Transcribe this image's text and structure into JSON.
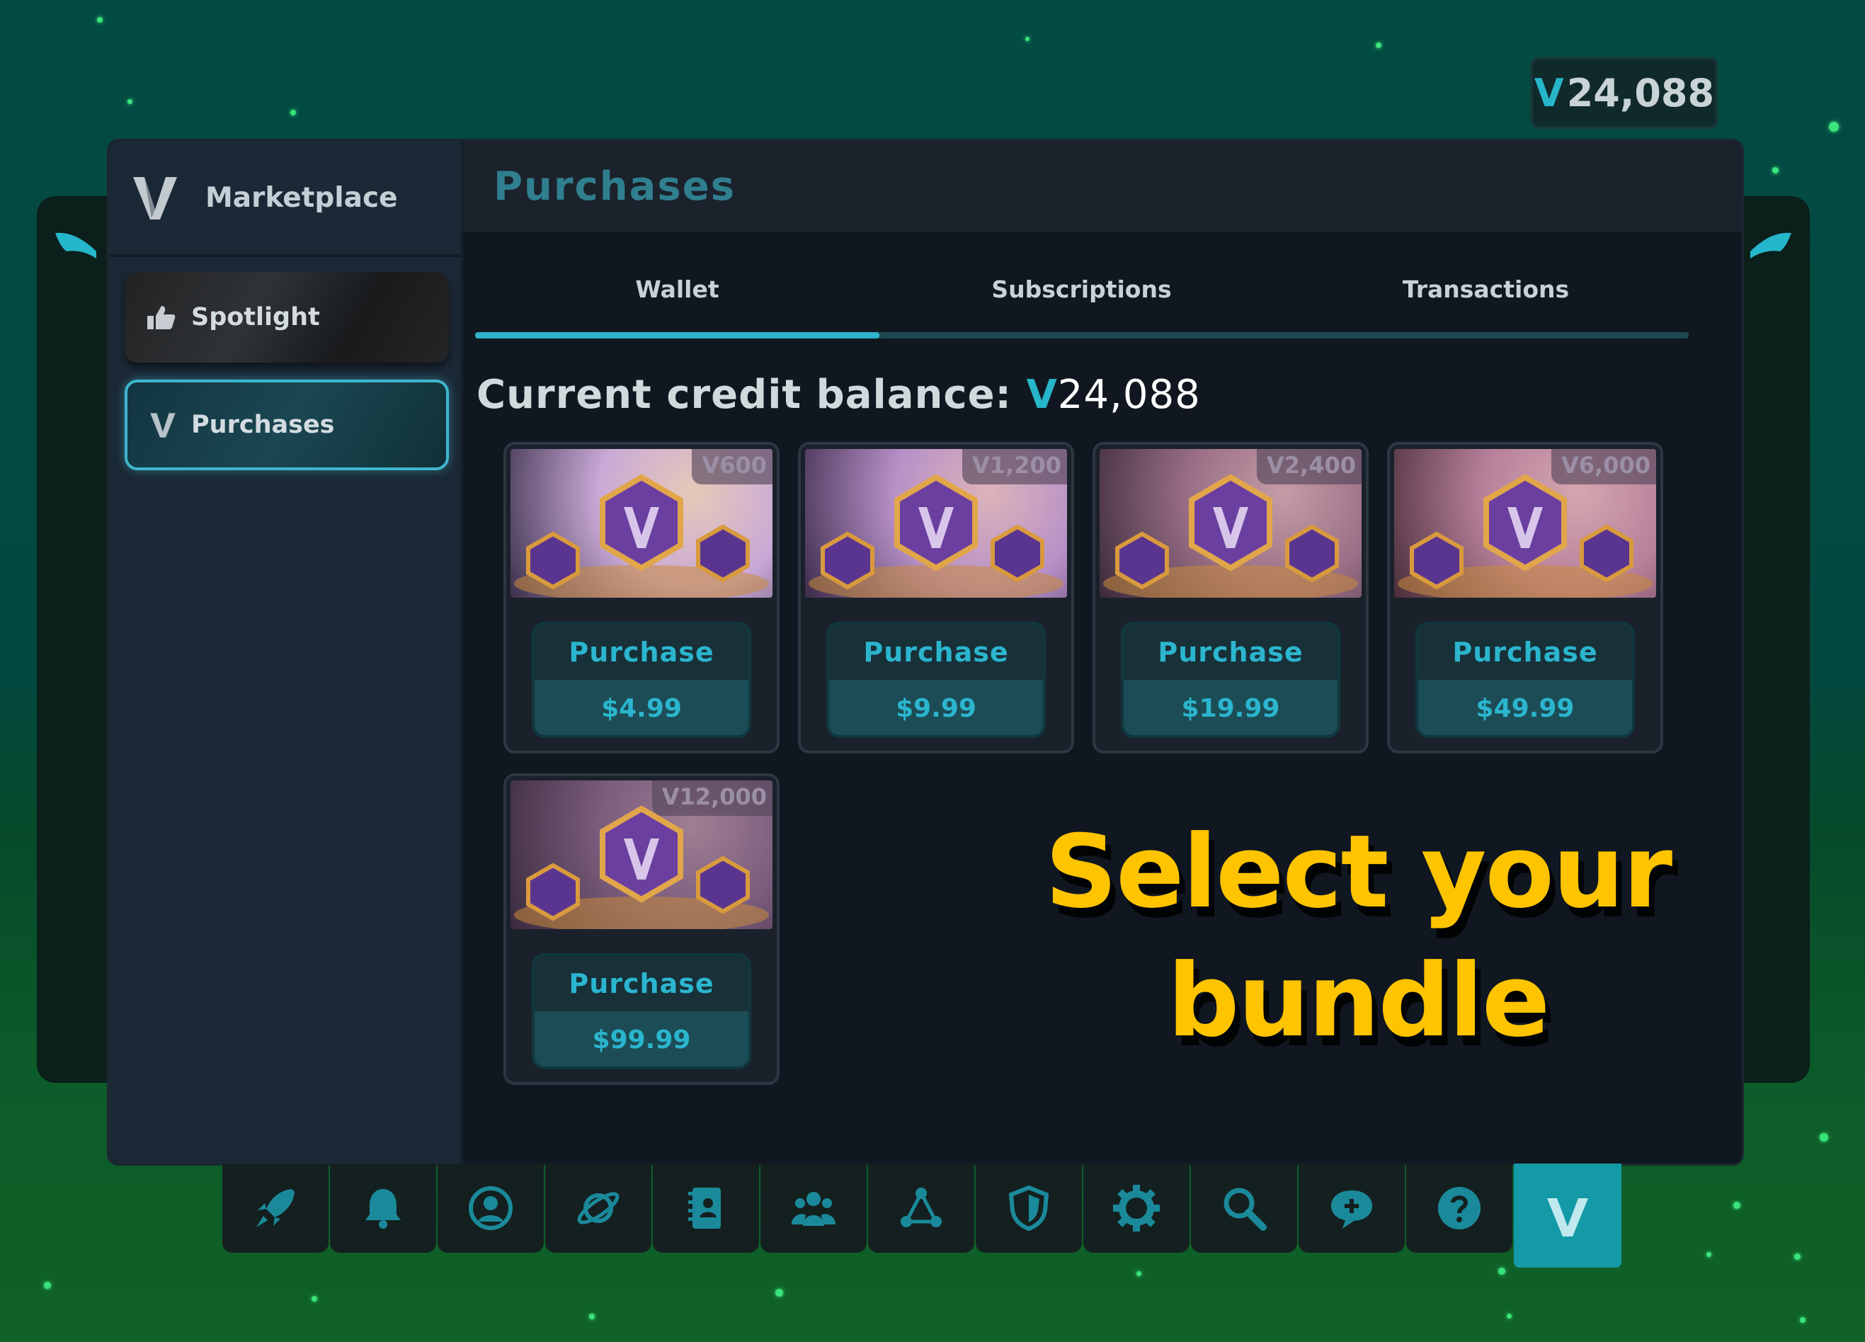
{
  "colors": {
    "accent": "#2fb2cb",
    "promo": "#ffc400",
    "dock_icon": "#1a8a9b"
  },
  "top_balance": {
    "symbol": "V",
    "amount": "24,088"
  },
  "sidebar": {
    "title": "Marketplace",
    "items": [
      {
        "label": "Spotlight",
        "icon": "thumbs-up-icon"
      },
      {
        "label": "Purchases",
        "icon": "v-logo-icon"
      }
    ]
  },
  "main": {
    "title": "Purchases",
    "tabs": [
      {
        "label": "Wallet",
        "active": true
      },
      {
        "label": "Subscriptions"
      },
      {
        "label": "Transactions"
      }
    ],
    "credit_label": "Current credit balance:",
    "credit_symbol": "V",
    "credit_amount": "24,088"
  },
  "bundles": [
    {
      "amount": "V600",
      "button": "Purchase",
      "price": "$4.99"
    },
    {
      "amount": "V1,200",
      "button": "Purchase",
      "price": "$9.99"
    },
    {
      "amount": "V2,400",
      "button": "Purchase",
      "price": "$19.99"
    },
    {
      "amount": "V6,000",
      "button": "Purchase",
      "price": "$49.99"
    },
    {
      "amount": "V12,000",
      "button": "Purchase",
      "price": "$99.99"
    }
  ],
  "promo": {
    "line1": "Select your",
    "line2": "bundle"
  },
  "dock": [
    "rocket-icon",
    "bell-icon",
    "profile-icon",
    "planet-icon",
    "notebook-icon",
    "group-icon",
    "network-icon",
    "shield-icon",
    "gear-icon",
    "search-icon",
    "chat-add-icon",
    "help-icon",
    "v-logo-icon"
  ]
}
